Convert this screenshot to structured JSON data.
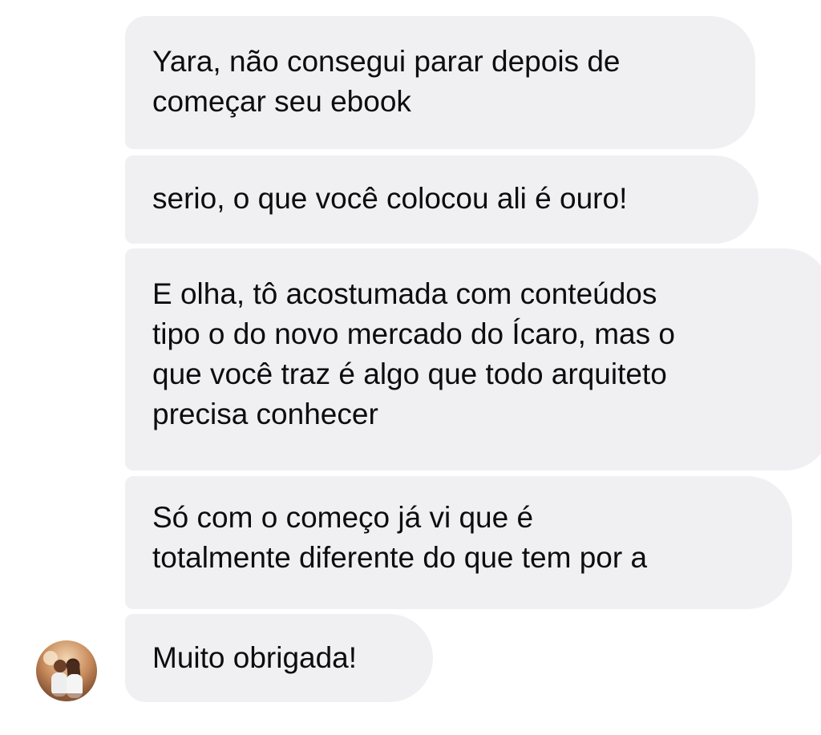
{
  "messages": [
    {
      "lines": [
        "Yara, não consegui parar depois de",
        "começar seu ebook"
      ]
    },
    {
      "lines": [
        "serio, o que você colocou ali é ouro!"
      ]
    },
    {
      "lines": [
        "E olha, tô acostumada com conteúdos",
        "tipo o do novo mercado do Ícaro, mas o",
        "que você traz é algo que todo arquiteto",
        "precisa conhecer"
      ]
    },
    {
      "lines": [
        "Só com o começo já vi que é",
        "totalmente diferente do que tem por a"
      ]
    },
    {
      "lines": [
        "Muito obrigada!"
      ]
    }
  ],
  "colors": {
    "bubble_background": "#f0f0f2",
    "text": "#0d0d0d",
    "page_background": "#ffffff"
  },
  "sender_avatar": {
    "icon": "profile-photo-avatar"
  }
}
